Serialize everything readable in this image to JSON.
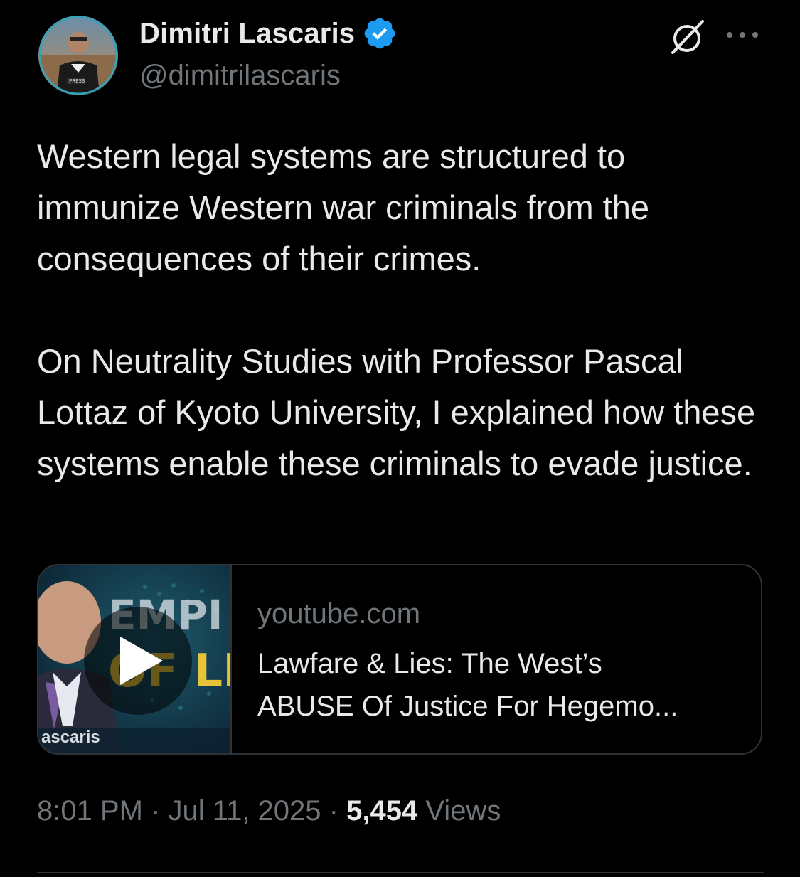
{
  "author": {
    "name": "Dimitri Lascaris",
    "handle": "@dimitrilascaris",
    "verified": true
  },
  "tweet": {
    "paragraphs": [
      "Western legal systems are structured to immunize Western war criminals from the consequences of their crimes.",
      "On Neutrality Studies with Professor Pascal Lottaz of Kyoto University, I explained how these systems enable these criminals to evade justice."
    ]
  },
  "link_card": {
    "domain": "youtube.com",
    "title_line1": "Lawfare & Lies: The West’s",
    "title_line2": "ABUSE Of Justice For Hegemo...",
    "thumbnail_caption": "ascaris",
    "thumbnail_banner_top": "EMPI",
    "thumbnail_banner_bottom": "OF LI"
  },
  "meta": {
    "time": "8:01 PM",
    "separator": "·",
    "date": "Jul 11, 2025",
    "views_count": "5,454",
    "views_label": "Views"
  },
  "colors": {
    "background": "#000000",
    "primary_text": "#e7e9ea",
    "secondary_text": "#71767b",
    "verified_blue": "#1d9bf0",
    "border": "#2f3336"
  },
  "icons": {
    "verified": "verified-badge-icon",
    "grok": "grok-icon",
    "more": "more-options-icon",
    "play": "play-icon"
  }
}
